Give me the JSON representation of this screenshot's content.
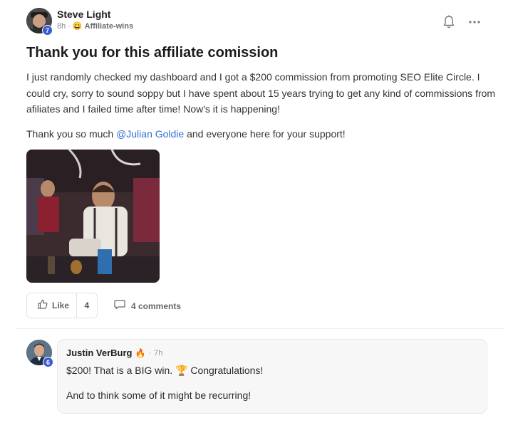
{
  "post": {
    "author": "Steve Light",
    "level": "7",
    "time_ago": "8h",
    "separator": "·",
    "category_emoji": "😀",
    "category": "Affiliate-wins",
    "title": "Thank you for this affiliate comission",
    "paragraph_1": "I just randomly checked my dashboard and I got a $200 commission from promoting SEO Elite Circle. I could cry, sorry to sound soppy but I have spent about 15 years trying to get any kind of commissions from afiliates and I failed time after time! Now's it is happening!",
    "paragraph_2_before": "Thank you so much ",
    "mention": "@Julian Goldie",
    "paragraph_2_after": " and everyone here for your support!",
    "like_label": "Like",
    "like_count": "4",
    "comments_label": "4 comments"
  },
  "icons": {
    "bell": "bell-icon",
    "more": "more-options-icon",
    "like": "thumbs-up-icon",
    "comment": "speech-bubble-icon"
  },
  "comment": {
    "author": "Justin VerBurg",
    "author_emoji": "🔥",
    "separator": "·",
    "time_ago": "7h",
    "level": "6",
    "line_1": "$200! That is a BIG win. 🏆 Congratulations!",
    "line_2": "And to think some of it might be recurring!"
  },
  "colors": {
    "mention": "#2f6fd6",
    "level_badge": "#3d5bd0"
  }
}
